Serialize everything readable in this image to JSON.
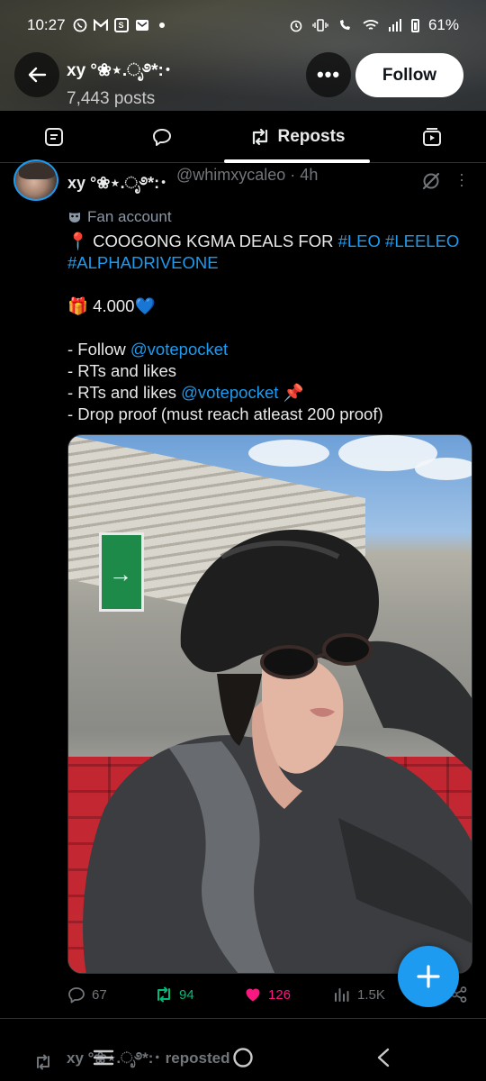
{
  "status_bar": {
    "time": "10:27",
    "battery": "61%"
  },
  "header": {
    "name": "xy °❀⋆.ೃ࿔*:･",
    "posts": "7,443 posts",
    "follow_label": "Follow",
    "more_label": "•••"
  },
  "tabs": [
    {
      "label": "",
      "icon": "article-icon"
    },
    {
      "label": "",
      "icon": "reply-icon"
    },
    {
      "label": "Reposts",
      "icon": "repost-icon",
      "active": true
    },
    {
      "label": "",
      "icon": "media-icon"
    }
  ],
  "post": {
    "author_name": "xy °❀⋆.ೃ࿔*:･",
    "handle_time": "@whimxycaleo · 4h",
    "label": "Fan account",
    "lines": {
      "l1_prefix": "📍 COOGONG KGMA DEALS FOR ",
      "l1_tag1": "#LEO",
      "l1_tag2": "#LEELEO",
      "l2_tag": "#ALPHADRIVEONE",
      "l3": "🎁 4.000💙",
      "l4_prefix": "- Follow ",
      "l4_link": "@votepocket",
      "l5": "- RTs and likes",
      "l6_prefix": "- RTs and likes ",
      "l6_link": "@votepocket",
      "l6_suffix": " 📌",
      "l7": "- Drop proof (must reach atleast 200 proof)"
    },
    "stats": {
      "replies": "67",
      "reposts": "94",
      "likes": "126",
      "views": "1.5K"
    }
  },
  "bottom": {
    "reposted_text": "xy °❀⋆.ೃ࿔*:･ reposted"
  },
  "colors": {
    "accent": "#1d9bf0",
    "repost_green": "#00ba7c",
    "like_pink": "#f91880"
  }
}
